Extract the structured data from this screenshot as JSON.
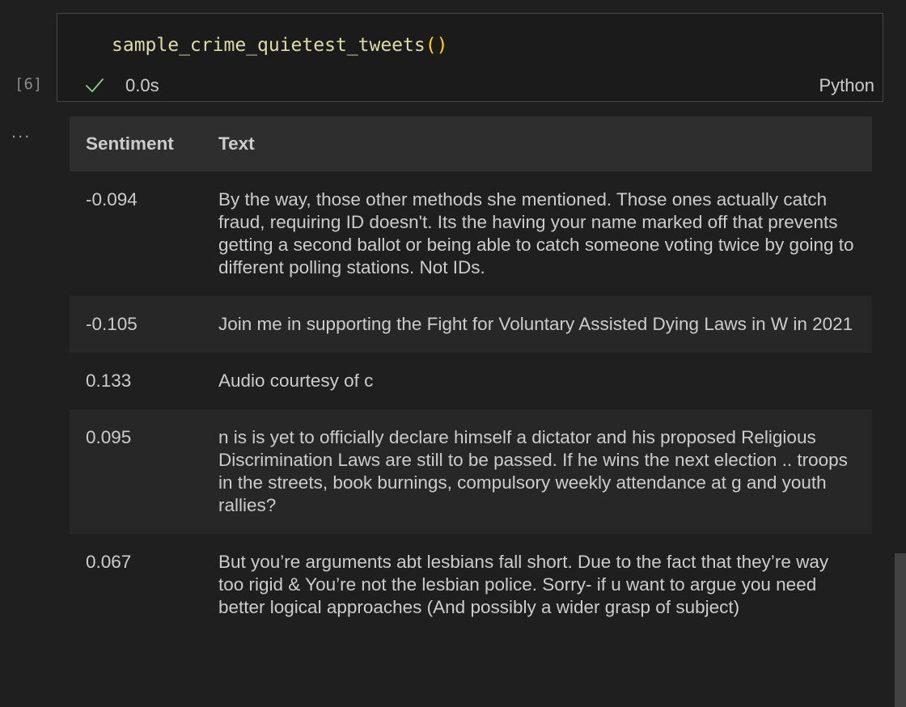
{
  "cell": {
    "execution_count": "[6]",
    "code_function": "sample_crime_quietest_tweets",
    "code_parens": "()",
    "status_icon": "check-icon",
    "duration": "0.0s",
    "language": "Python",
    "output_menu": "..."
  },
  "table": {
    "headers": [
      "Sentiment",
      "Text"
    ],
    "rows": [
      {
        "sentiment": "-0.094",
        "text": "By the way, those other methods she mentioned. Those ones actually catch fraud, requiring ID doesn't. Its the having your name marked off that prevents getting a second ballot or being able to catch someone voting twice by going to different polling stations. Not IDs."
      },
      {
        "sentiment": "-0.105",
        "text": "Join me in supporting the Fight for Voluntary Assisted Dying Laws in W in 2021"
      },
      {
        "sentiment": "0.133",
        "text": "Audio courtesy of c"
      },
      {
        "sentiment": "0.095",
        "text": "n is is yet to officially declare himself a dictator and his proposed Religious Discrimination Laws are still to be passed. If he wins the next election .. troops in the streets, book burnings, compulsory weekly attendance at g and youth rallies?"
      },
      {
        "sentiment": "0.067",
        "text": "But you’re arguments abt lesbians fall short. Due to the fact that they’re way too rigid & You’re not the lesbian police. Sorry- if u want to argue you need better logical approaches (And possibly a wider grasp of subject)"
      }
    ]
  },
  "colors": {
    "background": "#1f1f1f",
    "function_name": "#dcdcaa",
    "paren": "#ffd700",
    "success_check": "#89d185",
    "header_row": "#2e2e2e",
    "alt_row": "#272727"
  }
}
